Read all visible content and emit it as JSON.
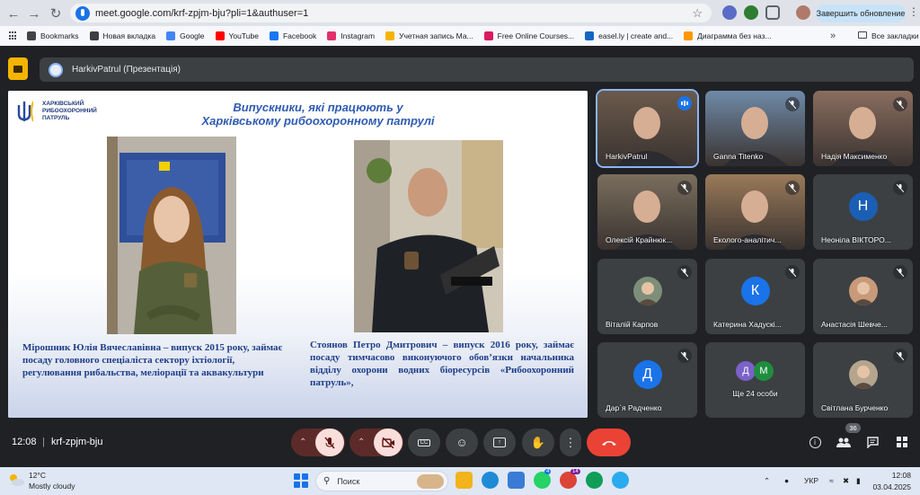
{
  "browser": {
    "url": "meet.google.com/krf-zpjm-bju?pli=1&authuser=1",
    "update_label": "Завершить обновление",
    "bookmarks": [
      {
        "label": "Bookmarks",
        "color": "#444444"
      },
      {
        "label": "Новая вкладка",
        "color": "#3c4043"
      },
      {
        "label": "Google",
        "color": "#4285f4"
      },
      {
        "label": "YouTube",
        "color": "#ff0000"
      },
      {
        "label": "Facebook",
        "color": "#1877f2"
      },
      {
        "label": "Instagram",
        "color": "#e1306c"
      },
      {
        "label": "Учетная запись Ма...",
        "color": "#f4b400"
      },
      {
        "label": "Free Online Courses...",
        "color": "#d81b60"
      },
      {
        "label": "easel.ly | create and...",
        "color": "#1565c0"
      },
      {
        "label": "Диаграмма без наз...",
        "color": "#ff9800"
      }
    ],
    "all_bookmarks": "Все закладки"
  },
  "meeting": {
    "title": "HarkivPatrul (Презентація)",
    "time": "12:08",
    "separator": "|",
    "code": "krf-zpjm-bju",
    "participants_count": "36"
  },
  "slide": {
    "logo_text": "ХАРКІВСЬКИЙ РИБООХОРОННИЙ ПАТРУЛЬ",
    "title_line1": "Випускники, які працюють у",
    "title_line2": "Харківському рибоохоронному патрулі",
    "caption1": "Мірошник Юлія Вячеславівна – випуск 2015 року, займає посаду головного спеціаліста сектору іхтіології, регулювання рибальства, меліорації та аквакультури",
    "caption2": "Стоянов Петро Дмитрович – випуск 2016 року, займає посаду тимчасово виконуючого обов’язки начальника відділу охорони водних біоресурсів «Рибоохоронний патруль»,"
  },
  "tiles": [
    {
      "name": "HarkivPatrul",
      "kind": "video",
      "bg": "#6b5a4c"
    },
    {
      "name": "Ganna Titenko",
      "kind": "video",
      "bg": "#6f8aa8"
    },
    {
      "name": "Надія Максименко",
      "kind": "video",
      "bg": "#8a6d60"
    },
    {
      "name": "Олексій Крайнюк...",
      "kind": "video",
      "bg": "#7a6e5d"
    },
    {
      "name": "Еколого-аналітич...",
      "kind": "video",
      "bg": "#9a7a5a"
    },
    {
      "name": "Неоніла ВІКТОРО...",
      "kind": "letter",
      "letter": "Н",
      "color": "#1a5fb4"
    },
    {
      "name": "Віталій Карпов",
      "kind": "photo",
      "bg": "#7d8f78"
    },
    {
      "name": "Катерина Хадускі...",
      "kind": "letter",
      "letter": "К",
      "color": "#1a73e8"
    },
    {
      "name": "Анастасія Шевче...",
      "kind": "photo",
      "bg": "#c89a7a"
    },
    {
      "name": "Дар`я Радченко",
      "kind": "letter",
      "letter": "Д",
      "color": "#1a73e8"
    },
    {
      "name": "Ще 24 особи",
      "kind": "group",
      "letters": [
        "Д",
        "М"
      ]
    },
    {
      "name": "Світлана Бурченко",
      "kind": "photo",
      "bg": "#b5a58e"
    }
  ],
  "taskbar": {
    "temp": "12°C",
    "weather": "Mostly cloudy",
    "search_placeholder": "Поиск",
    "lang": "УКР",
    "time": "12:08",
    "date": "03.04.2025",
    "badge1": "4",
    "badge2": "14"
  }
}
